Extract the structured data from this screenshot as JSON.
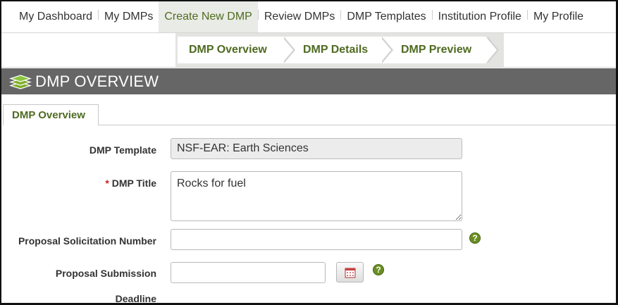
{
  "nav": {
    "items": [
      {
        "label": "My Dashboard"
      },
      {
        "label": "My DMPs"
      },
      {
        "label": "Create New DMP"
      },
      {
        "label": "Review DMPs"
      },
      {
        "label": "DMP Templates"
      },
      {
        "label": "Institution Profile"
      },
      {
        "label": "My Profile"
      }
    ],
    "active": "Create New DMP"
  },
  "wizard": {
    "steps": [
      {
        "label": "DMP Overview"
      },
      {
        "label": "DMP Details"
      },
      {
        "label": "DMP Preview"
      }
    ]
  },
  "section": {
    "icon": "layers-icon",
    "title": "DMP OVERVIEW"
  },
  "tab": {
    "label": "DMP Overview"
  },
  "form": {
    "template": {
      "label": "DMP Template",
      "value": "NSF-EAR: Earth Sciences"
    },
    "title": {
      "required_marker": "*",
      "label": "DMP Title",
      "value": "Rocks for fuel"
    },
    "solicitation": {
      "label": "Proposal Solicitation Number",
      "value": "",
      "help_icon": "help-icon"
    },
    "deadline": {
      "label_line1": "Proposal Submission",
      "label_line2": "Deadline",
      "value": "",
      "calendar_icon": "calendar-icon",
      "help_icon": "help-icon"
    }
  },
  "colors": {
    "accent_green": "#4f6b22",
    "help_green": "#6b8e23",
    "section_bar": "#666666",
    "required_red": "#cc2222"
  }
}
